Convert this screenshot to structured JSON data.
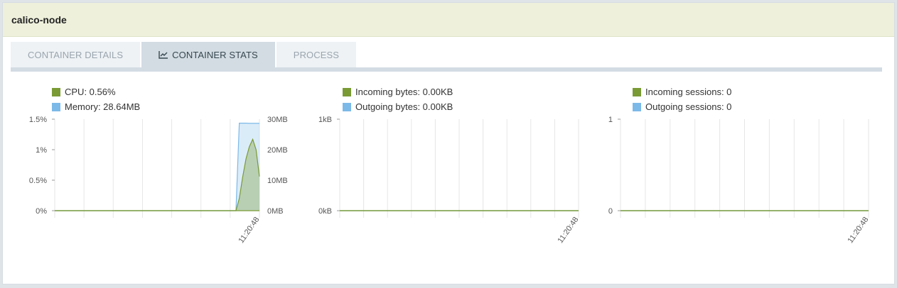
{
  "panel": {
    "title": "calico-node"
  },
  "tabs": [
    {
      "label": "CONTAINER DETAILS",
      "active": false
    },
    {
      "label": "CONTAINER STATS",
      "active": true,
      "icon": "line-chart-icon"
    },
    {
      "label": "PROCESS",
      "active": false
    }
  ],
  "colors": {
    "green": "#7a9a35",
    "blue": "#7cb9e8",
    "header_bg": "#eef0db",
    "tab_active": "#d3dce3"
  },
  "chart_data": [
    {
      "type": "area",
      "legend": [
        {
          "label": "CPU: 0.56%",
          "color": "#7a9a35"
        },
        {
          "label": "Memory: 28.64MB",
          "color": "#7cb9e8"
        }
      ],
      "y_left_ticks": [
        "1.5%",
        "1%",
        "0.5%",
        "0%"
      ],
      "y_right_ticks": [
        "30MB",
        "20MB",
        "10MB",
        "0MB"
      ],
      "x_tick": "11:20:48",
      "series": [
        {
          "name": "CPU",
          "unit": "%",
          "ylim": [
            0,
            1.5
          ],
          "values": [
            0,
            0,
            0,
            0,
            0,
            0,
            0,
            0,
            0,
            0,
            0,
            0,
            0,
            0,
            0,
            0,
            0,
            0,
            0,
            0,
            0,
            0,
            0,
            0,
            0,
            0,
            0,
            0,
            0,
            0,
            0,
            0,
            0,
            0,
            0,
            0,
            0,
            0,
            0,
            0,
            0,
            0,
            0,
            0,
            0,
            0,
            0,
            0,
            0,
            0,
            0,
            0,
            0,
            0,
            0.0,
            0.2,
            0.55,
            0.85,
            1.05,
            1.17,
            1.0,
            0.56
          ]
        },
        {
          "name": "Memory",
          "unit": "MB",
          "ylim": [
            0,
            30
          ],
          "values": [
            0,
            0,
            0,
            0,
            0,
            0,
            0,
            0,
            0,
            0,
            0,
            0,
            0,
            0,
            0,
            0,
            0,
            0,
            0,
            0,
            0,
            0,
            0,
            0,
            0,
            0,
            0,
            0,
            0,
            0,
            0,
            0,
            0,
            0,
            0,
            0,
            0,
            0,
            0,
            0,
            0,
            0,
            0,
            0,
            0,
            0,
            0,
            0,
            0,
            0,
            0,
            0,
            0,
            0,
            0,
            28.7,
            28.7,
            28.7,
            28.64,
            28.64,
            28.64,
            28.64
          ]
        }
      ]
    },
    {
      "type": "area",
      "legend": [
        {
          "label": "Incoming bytes: 0.00KB",
          "color": "#7a9a35"
        },
        {
          "label": "Outgoing bytes: 0.00KB",
          "color": "#7cb9e8"
        }
      ],
      "y_left_ticks": [
        "1kB",
        "0kB"
      ],
      "x_tick": "11:20:48",
      "series": [
        {
          "name": "Incoming bytes",
          "ylim": [
            0,
            1
          ],
          "values": [
            0,
            0
          ]
        },
        {
          "name": "Outgoing bytes",
          "ylim": [
            0,
            1
          ],
          "values": [
            0,
            0
          ]
        }
      ]
    },
    {
      "type": "area",
      "legend": [
        {
          "label": "Incoming sessions: 0",
          "color": "#7a9a35"
        },
        {
          "label": "Outgoing sessions: 0",
          "color": "#7cb9e8"
        }
      ],
      "y_left_ticks": [
        "1",
        "0"
      ],
      "x_tick": "11:20:48",
      "series": [
        {
          "name": "Incoming sessions",
          "ylim": [
            0,
            1
          ],
          "values": [
            0,
            0
          ]
        },
        {
          "name": "Outgoing sessions",
          "ylim": [
            0,
            1
          ],
          "values": [
            0,
            0
          ]
        }
      ]
    }
  ]
}
